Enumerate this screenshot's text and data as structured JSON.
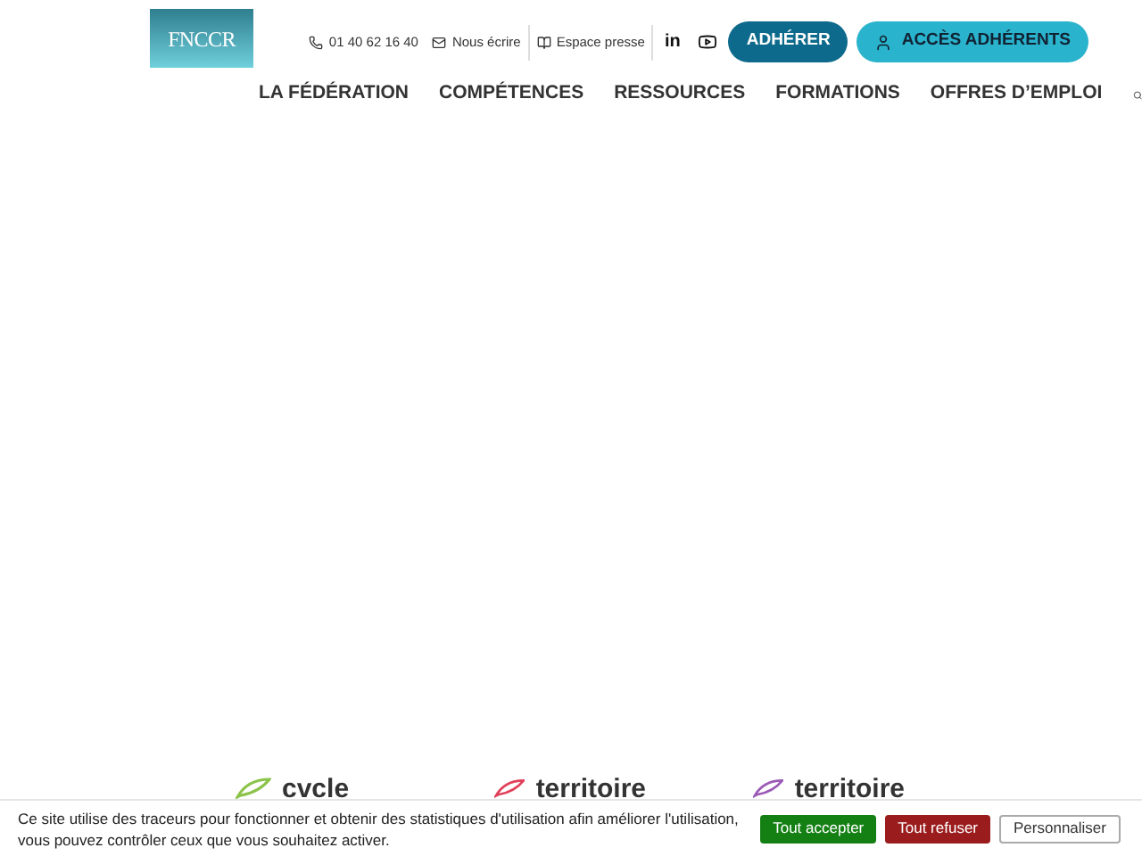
{
  "logo": {
    "text": "FNCCR"
  },
  "contacts": [
    {
      "kind": "phone",
      "label": "01 40 62 16 40"
    },
    {
      "kind": "mail",
      "label": "Nous écrire"
    },
    {
      "kind": "book",
      "label": "Espace presse"
    }
  ],
  "social": [
    {
      "kind": "linkedin",
      "label": "in"
    },
    {
      "kind": "youtube"
    }
  ],
  "buttons": [
    {
      "kind": "primary",
      "label": "ADHÉRER"
    },
    {
      "kind": "account",
      "label": "ACCÈS ADHÉRENTS"
    }
  ],
  "nav": [
    "LA FÉDÉRATION",
    "COMPÉTENCES",
    "RESSOURCES",
    "FORMATIONS",
    "OFFRES D’EMPLOI"
  ],
  "partners": [
    {
      "label": "cvcle",
      "color": "#8bc34a"
    },
    {
      "label": "territoire",
      "color": "#e0405a"
    },
    {
      "label": "territoire",
      "color": "#9b59b6"
    }
  ],
  "cookie_banner": {
    "text": "Ce site utilise des traceurs pour fonctionner et obtenir des statistiques d'utilisation afin améliorer l'utilisation, vous pouvez contrôler ceux que vous souhaitez activer.",
    "buttons": [
      {
        "kind": "accept",
        "label": "Tout accepter"
      },
      {
        "kind": "refuse",
        "label": "Tout refuser"
      },
      {
        "kind": "custom",
        "label": "Personnaliser"
      }
    ]
  }
}
